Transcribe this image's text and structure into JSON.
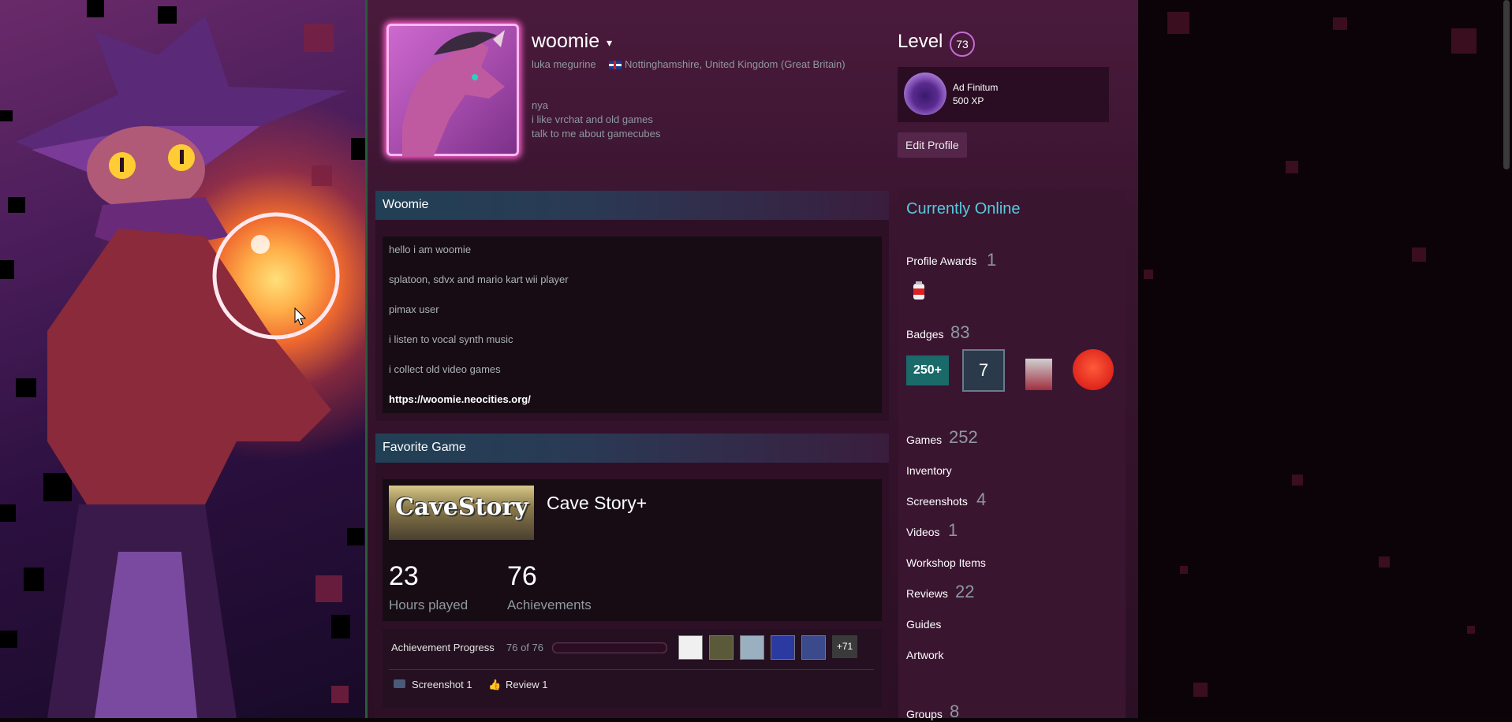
{
  "profile": {
    "persona_name": "woomie",
    "real_name": "luka megurine",
    "location": "Nottinghamshire, United Kingdom (Great Britain)",
    "summary": [
      "nya",
      "i like vrchat and old games",
      "talk to me about gamecubes"
    ],
    "level_label": "Level",
    "level": "73",
    "featured_badge": {
      "name": "Ad Finitum",
      "xp": "500 XP"
    },
    "edit_button": "Edit Profile"
  },
  "about_showcase": {
    "title": "Woomie",
    "lines": [
      "hello i am woomie",
      "splatoon, sdvx and mario kart wii player",
      "pimax user",
      "i listen to vocal synth music",
      "i collect old video games"
    ],
    "link": "https://woomie.neocities.org/"
  },
  "favorite_game": {
    "title": "Favorite Game",
    "game_name": "Cave Story+",
    "capsule_text": "CaveStory",
    "hours": "23",
    "hours_label": "Hours played",
    "achievements": "76",
    "achievements_label": "Achievements",
    "progress_label": "Achievement Progress",
    "progress_text": "76 of 76",
    "progress_fraction": 1.0,
    "more_achievements": "+71",
    "screenshot_link": "Screenshot 1",
    "review_link": "Review 1"
  },
  "sidebar": {
    "status": "Currently Online",
    "profile_awards_label": "Profile Awards",
    "profile_awards_count": "1",
    "badges_label": "Badges",
    "badges_count": "83",
    "badge_250": "250+",
    "badge_7": "7",
    "games_label": "Games",
    "games_count": "252",
    "inventory_label": "Inventory",
    "screenshots_label": "Screenshots",
    "screenshots_count": "4",
    "videos_label": "Videos",
    "videos_count": "1",
    "workshop_label": "Workshop Items",
    "reviews_label": "Reviews",
    "reviews_count": "22",
    "guides_label": "Guides",
    "artwork_label": "Artwork",
    "groups_label": "Groups",
    "groups_count": "8"
  },
  "icons": {
    "flag": "uk-flag-icon",
    "caret": "chevron-down-icon",
    "screenshot": "camera-icon",
    "review": "thumbs-up-icon"
  },
  "colors": {
    "online_status": "#57cbde",
    "level_ring": "#c46bd3",
    "avatar_glow": "#ff5fd0"
  }
}
